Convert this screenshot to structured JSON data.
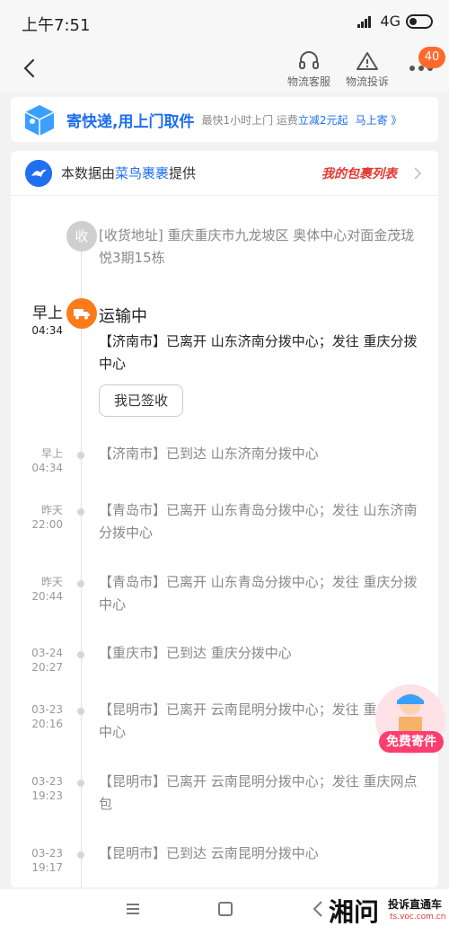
{
  "status": {
    "time": "上午7:51",
    "network": "4G"
  },
  "nav": {
    "service_label": "物流客服",
    "complaint_label": "物流投诉",
    "badge_count": "40"
  },
  "promo": {
    "title": "寄快递,用上门取件",
    "sub_prefix": "最快1小时上门 运费",
    "sub_highlight": "立减2元起",
    "link": "马上寄 》"
  },
  "source": {
    "prefix": "本数据由",
    "name": "菜鸟裹裹",
    "suffix": "提供",
    "parcel_list": "我的包裹列表"
  },
  "address": {
    "icon_text": "收",
    "text": "[收货地址] 重庆重庆市九龙坡区 奥体中心对面金茂珑悦3期15栋"
  },
  "current": {
    "day": "早上",
    "time": "04:34",
    "status": "运输中",
    "text": "【济南市】已离开 山东济南分拨中心；发往 重庆分拨中心",
    "sign_button": "我已签收"
  },
  "events": [
    {
      "day": "早上",
      "time": "04:34",
      "text": "【济南市】已到达 山东济南分拨中心"
    },
    {
      "day": "昨天",
      "time": "22:00",
      "text": "【青岛市】已离开 山东青岛分拨中心；发往 山东济南分拨中心"
    },
    {
      "day": "昨天",
      "time": "20:44",
      "text": "【青岛市】已离开 山东青岛分拨中心；发往 重庆分拨中心"
    },
    {
      "day": "03-24",
      "time": "20:27",
      "text": "【重庆市】已到达 重庆分拨中心"
    },
    {
      "day": "03-23",
      "time": "20:16",
      "text": "【昆明市】已离开 云南昆明分拨中心；发往 重庆分拨中心"
    },
    {
      "day": "03-23",
      "time": "19:23",
      "text": "【昆明市】已离开 云南昆明分拨中心；发往 重庆网点包"
    },
    {
      "day": "03-23",
      "time": "19:17",
      "text": "【昆明市】已到达 云南昆明分拨中心"
    }
  ],
  "float_button": {
    "label": "免费寄件"
  },
  "watermark": {
    "main": "湘问",
    "sub": "投诉直通车",
    "url": "ts.voc.com.cn"
  },
  "colors": {
    "accent": "#1f6ff0",
    "orange": "#ff7a1a",
    "red": "#e6372f"
  }
}
